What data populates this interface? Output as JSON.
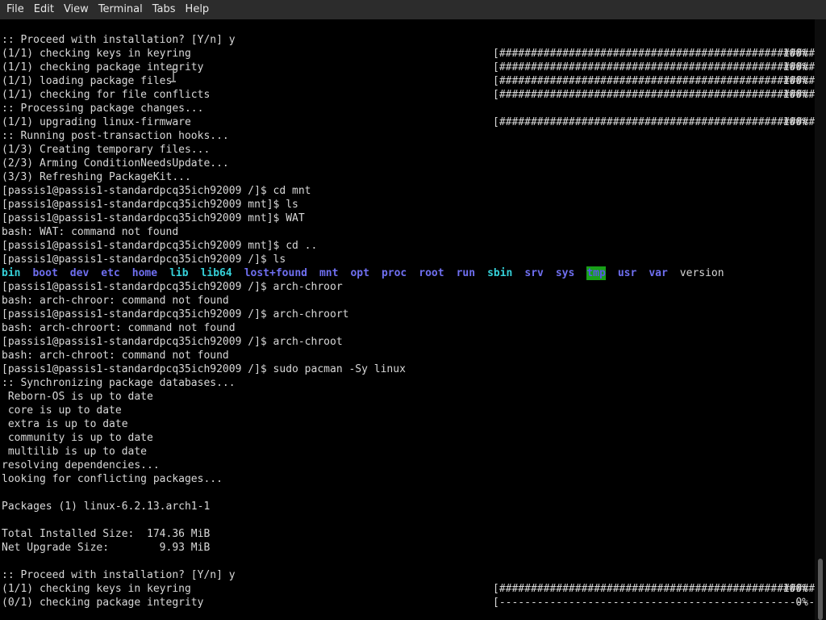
{
  "menubar": {
    "items": [
      "File",
      "Edit",
      "View",
      "Terminal",
      "Tabs",
      "Help"
    ]
  },
  "terminal": {
    "lines": [
      {
        "text": ":: Proceed with installation? [Y/n] y"
      },
      {
        "text": "(1/1) checking keys in keyring",
        "bar": "[######################################################]",
        "pct": "100%"
      },
      {
        "text": "(1/1) checking package integrity",
        "bar": "[######################################################]",
        "pct": "100%"
      },
      {
        "text": "(1/1) loading package files",
        "bar": "[######################################################]",
        "pct": "100%"
      },
      {
        "text": "(1/1) checking for file conflicts",
        "bar": "[######################################################]",
        "pct": "100%"
      },
      {
        "text": ":: Processing package changes..."
      },
      {
        "text": "(1/1) upgrading linux-firmware",
        "bar": "[######################################################]",
        "pct": "100%"
      },
      {
        "text": ":: Running post-transaction hooks..."
      },
      {
        "text": "(1/3) Creating temporary files..."
      },
      {
        "text": "(2/3) Arming ConditionNeedsUpdate..."
      },
      {
        "text": "(3/3) Refreshing PackageKit..."
      },
      {
        "text": "[passis1@passis1-standardpcq35ich92009 /]$ cd mnt"
      },
      {
        "text": "[passis1@passis1-standardpcq35ich92009 mnt]$ ls"
      },
      {
        "text": "[passis1@passis1-standardpcq35ich92009 mnt]$ WAT"
      },
      {
        "text": "bash: WAT: command not found"
      },
      {
        "text": "[passis1@passis1-standardpcq35ich92009 mnt]$ cd .."
      },
      {
        "text": "[passis1@passis1-standardpcq35ich92009 /]$ ls"
      },
      {
        "ls": [
          {
            "name": "bin",
            "kind": "link"
          },
          {
            "name": "boot",
            "kind": "dir"
          },
          {
            "name": "dev",
            "kind": "dir"
          },
          {
            "name": "etc",
            "kind": "dir"
          },
          {
            "name": "home",
            "kind": "dir"
          },
          {
            "name": "lib",
            "kind": "link"
          },
          {
            "name": "lib64",
            "kind": "link"
          },
          {
            "name": "lost+found",
            "kind": "dir"
          },
          {
            "name": "mnt",
            "kind": "dir"
          },
          {
            "name": "opt",
            "kind": "dir"
          },
          {
            "name": "proc",
            "kind": "dir"
          },
          {
            "name": "root",
            "kind": "dir"
          },
          {
            "name": "run",
            "kind": "dir"
          },
          {
            "name": "sbin",
            "kind": "link"
          },
          {
            "name": "srv",
            "kind": "dir"
          },
          {
            "name": "sys",
            "kind": "dir"
          },
          {
            "name": "tmp",
            "kind": "sticky"
          },
          {
            "name": "usr",
            "kind": "dir"
          },
          {
            "name": "var",
            "kind": "dir"
          },
          {
            "name": "version",
            "kind": "file"
          }
        ]
      },
      {
        "text": "[passis1@passis1-standardpcq35ich92009 /]$ arch-chroor"
      },
      {
        "text": "bash: arch-chroor: command not found"
      },
      {
        "text": "[passis1@passis1-standardpcq35ich92009 /]$ arch-chroort"
      },
      {
        "text": "bash: arch-chroort: command not found"
      },
      {
        "text": "[passis1@passis1-standardpcq35ich92009 /]$ arch-chroot"
      },
      {
        "text": "bash: arch-chroot: command not found"
      },
      {
        "text": "[passis1@passis1-standardpcq35ich92009 /]$ sudo pacman -Sy linux"
      },
      {
        "text": ":: Synchronizing package databases..."
      },
      {
        "text": " Reborn-OS is up to date"
      },
      {
        "text": " core is up to date"
      },
      {
        "text": " extra is up to date"
      },
      {
        "text": " community is up to date"
      },
      {
        "text": " multilib is up to date"
      },
      {
        "text": "resolving dependencies..."
      },
      {
        "text": "looking for conflicting packages..."
      },
      {
        "text": ""
      },
      {
        "text": "Packages (1) linux-6.2.13.arch1-1"
      },
      {
        "text": ""
      },
      {
        "text": "Total Installed Size:  174.36 MiB"
      },
      {
        "text": "Net Upgrade Size:        9.93 MiB"
      },
      {
        "text": ""
      },
      {
        "text": ":: Proceed with installation? [Y/n] y"
      },
      {
        "text": "(1/1) checking keys in keyring",
        "bar": "[######################################################]",
        "pct": "100%"
      },
      {
        "text": "(0/1) checking package integrity",
        "bar": "[------------------------------------------------------]",
        "pct": "0%"
      }
    ]
  },
  "colors": {
    "background": "#000000",
    "foreground": "#d8d8d8",
    "directory": "#6f6ff0",
    "symlink": "#35d0d8",
    "sticky_bg": "#18a018",
    "menubar_bg": "#2c2c2c"
  },
  "icons": {
    "mouse_cursor": "text-cursor-icon"
  }
}
